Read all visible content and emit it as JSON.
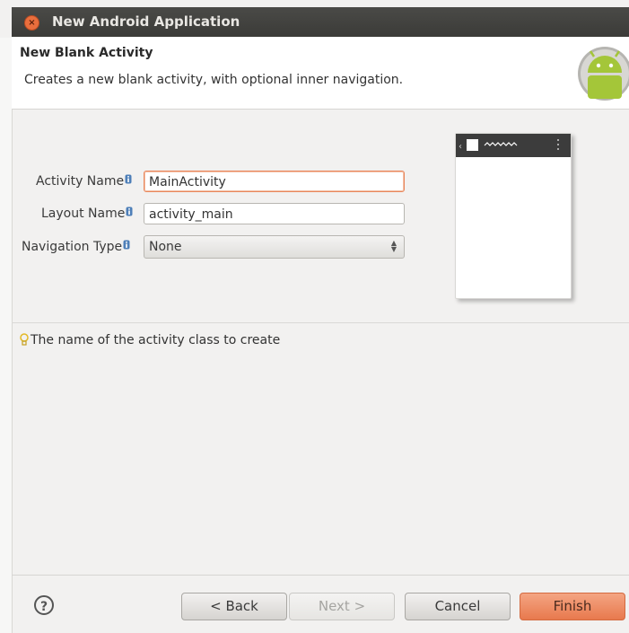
{
  "window": {
    "title": "New Android Application"
  },
  "header": {
    "title": "New Blank Activity",
    "description": "Creates a new blank activity, with optional inner navigation."
  },
  "form": {
    "activity_name": {
      "label": "Activity Name",
      "value": "MainActivity"
    },
    "layout_name": {
      "label": "Layout Name",
      "value": "activity_main"
    },
    "navigation_type": {
      "label": "Navigation Type",
      "value": "None"
    }
  },
  "hint": {
    "text": "The name of the activity class to create"
  },
  "buttons": {
    "help": "?",
    "back": "< Back",
    "next": "Next >",
    "cancel": "Cancel",
    "finish": "Finish"
  },
  "colors": {
    "accent": "#e8794d",
    "titlebar": "#3f3f3c",
    "android_green": "#a4c639"
  },
  "icons": [
    "close-icon",
    "android-logo-icon",
    "info-icon",
    "lightbulb-icon",
    "help-icon"
  ]
}
